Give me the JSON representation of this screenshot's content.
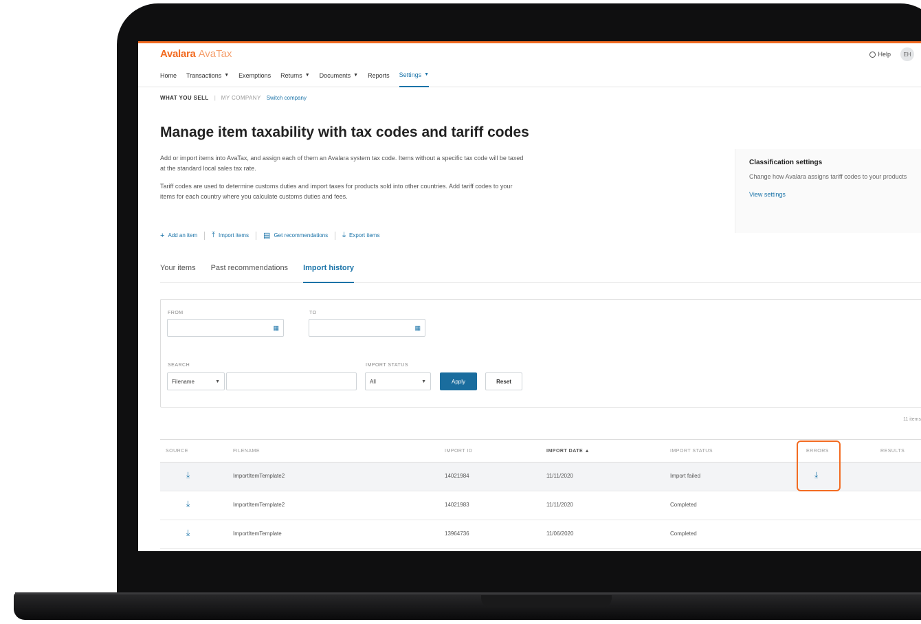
{
  "app": {
    "brand": "Avalara",
    "product": "AvaTax"
  },
  "topbar": {
    "help_label": "Help",
    "avatar_initials": "EH"
  },
  "nav": [
    {
      "label": "Home",
      "caret": false
    },
    {
      "label": "Transactions",
      "caret": true
    },
    {
      "label": "Exemptions",
      "caret": false
    },
    {
      "label": "Returns",
      "caret": true
    },
    {
      "label": "Documents",
      "caret": true
    },
    {
      "label": "Reports",
      "caret": false
    },
    {
      "label": "Settings",
      "caret": true
    }
  ],
  "breadcrumb": {
    "section": "WHAT YOU SELL",
    "company_label": "MY COMPANY",
    "company_link": "Switch company"
  },
  "page": {
    "title": "Manage item taxability with tax codes and tariff codes",
    "desc1": "Add or import items into AvaTax, and assign each of them an Avalara system tax code. Items without a specific tax code will be taxed at the standard local sales tax rate.",
    "desc2": "Tariff codes are used to determine customs duties and import taxes for products sold into other countries. Add tariff codes to your items for each country where you calculate customs duties and fees."
  },
  "side_panel": {
    "title": "Classification settings",
    "text": "Change how Avalara assigns tariff codes to your products",
    "link": "View settings"
  },
  "actions": [
    "Add an item",
    "Import items",
    "Get recommendations",
    "Export items"
  ],
  "tabs": [
    "Your items",
    "Past recommendations",
    "Import history"
  ],
  "active_tab": "Import history",
  "filters": {
    "from_label": "FROM",
    "to_label": "TO",
    "search_label": "SEARCH",
    "search_field_value": "Filename",
    "search_placeholder": "",
    "status_label": "IMPORT STATUS",
    "status_value": "All",
    "apply_label": "Apply",
    "reset_label": "Reset"
  },
  "results_count": "11 items",
  "table": {
    "headers": [
      "SOURCE",
      "FILENAME",
      "IMPORT ID",
      "IMPORT DATE",
      "IMPORT STATUS",
      "ERRORS",
      "RESULTS"
    ],
    "rows": [
      {
        "filename": "ImportItemTemplate2",
        "import_id": "14021984",
        "import_date": "11/11/2020",
        "status": "Import failed",
        "has_errors": true
      },
      {
        "filename": "ImportItemTemplate2",
        "import_id": "14021983",
        "import_date": "11/11/2020",
        "status": "Completed",
        "has_errors": false
      },
      {
        "filename": "ImportItemTemplate",
        "import_id": "13964736",
        "import_date": "11/06/2020",
        "status": "Completed",
        "has_errors": false
      }
    ]
  },
  "colors": {
    "brand_orange": "#f26b21",
    "link_blue": "#1a73a8",
    "primary_button": "#1a6d9e"
  }
}
